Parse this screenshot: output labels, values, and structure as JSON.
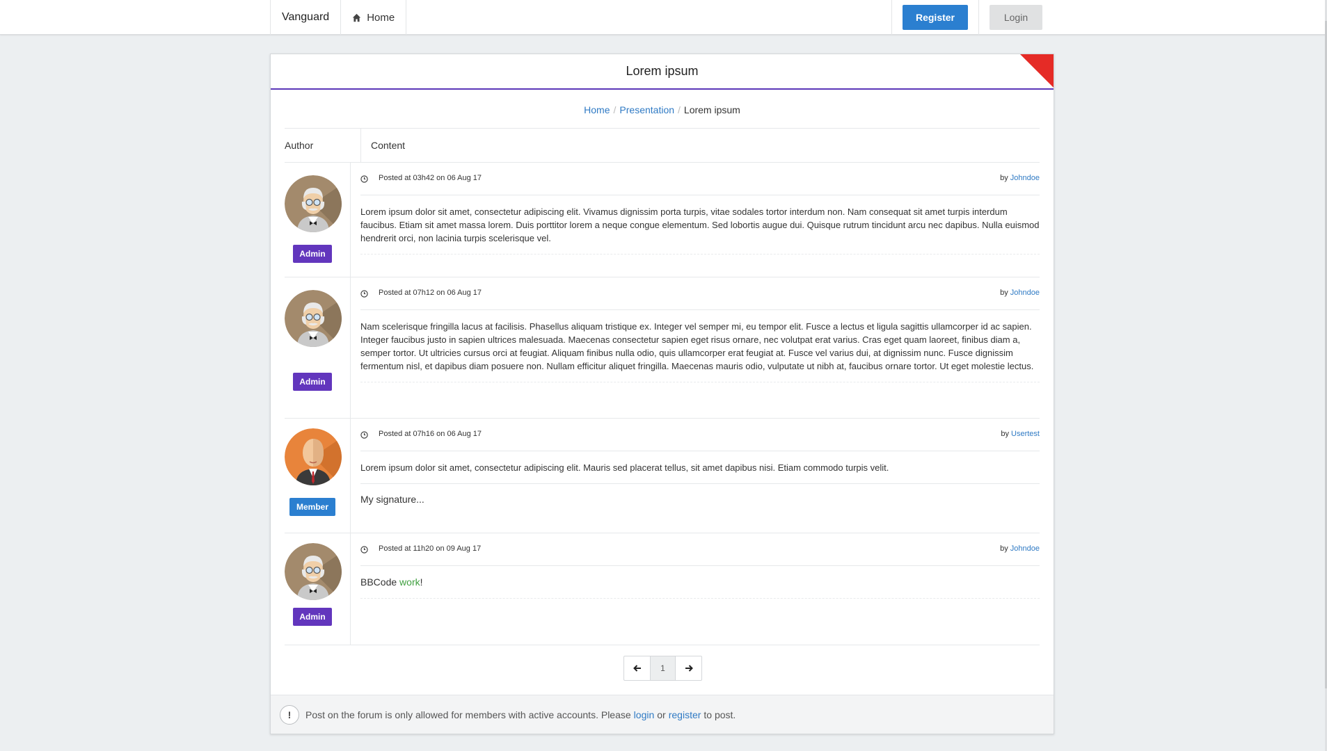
{
  "navbar": {
    "brand": "Vanguard",
    "home_label": "Home",
    "register_label": "Register",
    "login_label": "Login"
  },
  "panel": {
    "title": "Lorem ipsum",
    "breadcrumb": {
      "home": "Home",
      "presentation": "Presentation",
      "current": "Lorem ipsum"
    },
    "columns": {
      "author": "Author",
      "content": "Content"
    },
    "posts": [
      {
        "role": "Admin",
        "avatar": "old-man-avatar",
        "posted": "Posted at 03h42 on 06 Aug 17",
        "by": "by",
        "author": "Johndoe",
        "text": "Lorem ipsum dolor sit amet, consectetur adipiscing elit. Vivamus dignissim porta turpis, vitae sodales tortor interdum non. Nam consequat sit amet turpis interdum faucibus. Etiam sit amet massa lorem. Duis porttitor lorem a neque congue elementum. Sed lobortis augue dui. Quisque rutrum tincidunt arcu nec dapibus. Nulla euismod hendrerit orci, non lacinia turpis scelerisque vel."
      },
      {
        "role": "Admin",
        "avatar": "old-man-avatar",
        "posted": "Posted at 07h12 on 06 Aug 17",
        "by": "by",
        "author": "Johndoe",
        "text": "Nam scelerisque fringilla lacus at facilisis. Phasellus aliquam tristique ex. Integer vel semper mi, eu tempor elit. Fusce a lectus et ligula sagittis ullamcorper id ac sapien. Integer faucibus justo in sapien ultrices malesuada. Maecenas consectetur sapien eget risus ornare, nec volutpat erat varius. Cras eget quam laoreet, finibus diam a, semper tortor. Ut ultricies cursus orci at feugiat. Aliquam finibus nulla odio, quis ullamcorper erat feugiat at. Fusce vel varius dui, at dignissim nunc. Fusce dignissim fermentum nisl, et dapibus diam posuere non. Nullam efficitur aliquet fringilla. Maecenas mauris odio, vulputate ut nibh at, faucibus ornare tortor. Ut eget molestie lectus."
      },
      {
        "role": "Member",
        "avatar": "bald-man-avatar",
        "posted": "Posted at 07h16 on 06 Aug 17",
        "by": "by",
        "author": "Usertest",
        "text": "Lorem ipsum dolor sit amet, consectetur adipiscing elit. Mauris sed placerat tellus, sit amet dapibus nisi. Etiam commodo turpis velit.",
        "signature": "My signature..."
      },
      {
        "role": "Admin",
        "avatar": "old-man-avatar",
        "posted": "Posted at 11h20 on 09 Aug 17",
        "by": "by",
        "author": "Johndoe",
        "text_prefix": "BBCode ",
        "text_green": "work",
        "text_suffix": "!"
      }
    ],
    "pagination": {
      "current_page": "1"
    },
    "footer": {
      "icon": "!",
      "text_before": "Post on the forum is only allowed for members with active accounts. Please",
      "login_link": "login",
      "or": "or",
      "register_link": "register",
      "text_after": "to post."
    }
  },
  "colors": {
    "primary": "#2b7fd0",
    "admin_badge": "#6236bd",
    "corner": "#e52b26",
    "header_underline": "#5b36b8",
    "bbcode_green": "#3f9f3f"
  }
}
